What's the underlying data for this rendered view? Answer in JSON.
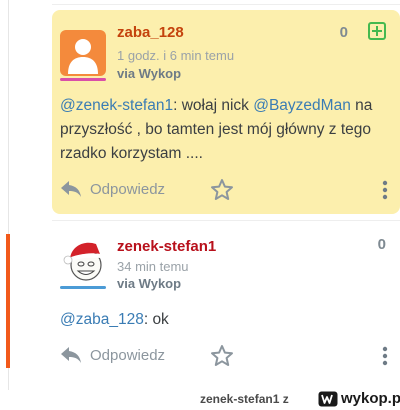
{
  "comments": [
    {
      "author": "zaba_128",
      "time": "1 godz. i 6 min temu",
      "via": "via Wykop",
      "votes": "0",
      "mention1": "@zenek-stefan1",
      "text1": ": wołaj nick ",
      "mention2": "@BayzedMan",
      "text2": " na przyszłość , bo tamten jest mój główny z tego rzadko korzystam ....",
      "reply_label": "Odpowiedz"
    },
    {
      "author": "zenek-stefan1",
      "time": "34 min temu",
      "via": "via Wykop",
      "votes": "0",
      "mention1": "@zaba_128",
      "text1": ": ok",
      "reply_label": "Odpowiedz"
    }
  ],
  "footer": {
    "user": "zenek-stefan1 z",
    "logo": "wykop.pl"
  },
  "colors": {
    "highlight_bg": "#fcefad",
    "mention": "#3a7cb4",
    "accent": "#f2591a",
    "plus": "#45b94f"
  },
  "icons": [
    "user-avatar-icon",
    "meme-avatar-icon",
    "plus-icon",
    "reply-arrow-icon",
    "star-icon",
    "more-vertical-icon",
    "wykop-logo-icon"
  ]
}
